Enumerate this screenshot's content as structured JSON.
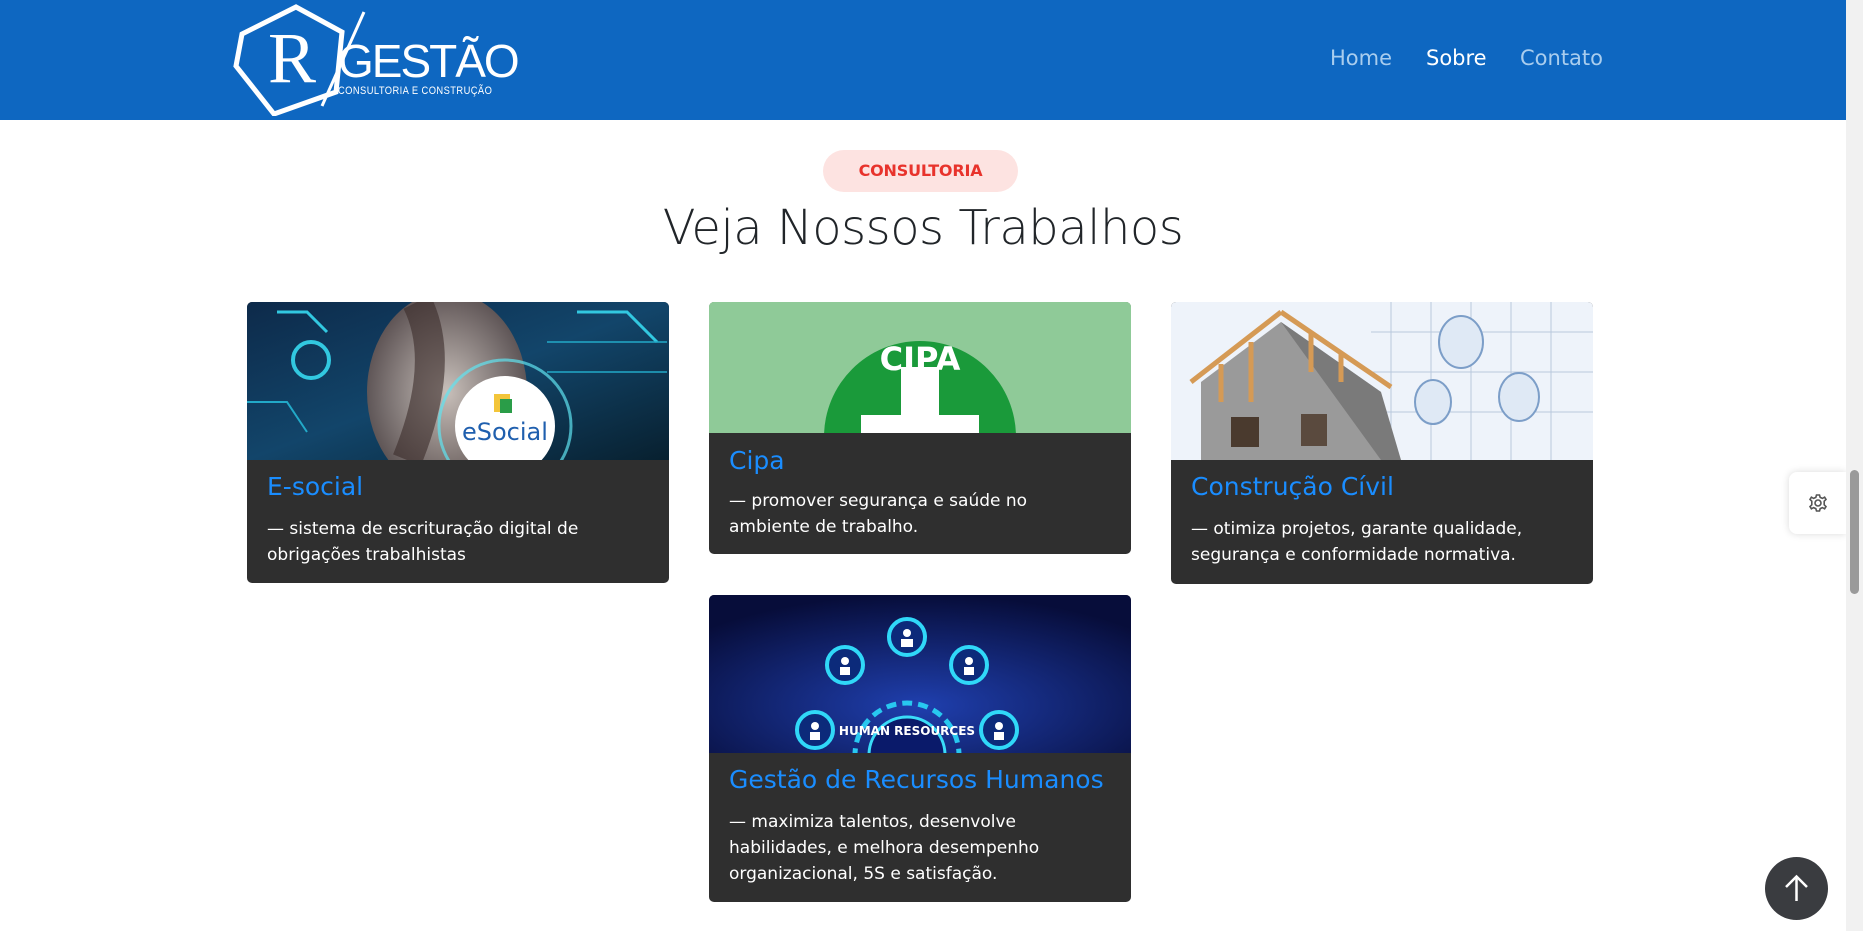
{
  "brand": {
    "logo_letter": "R",
    "name": "GESTÃO",
    "tagline": "CONSULTORIA E CONSTRUÇÃO"
  },
  "nav": {
    "home": "Home",
    "sobre": "Sobre",
    "contato": "Contato",
    "active": "Sobre"
  },
  "section": {
    "badge": "CONSULTORIA",
    "title": "Veja Nossos Trabalhos"
  },
  "cards": [
    {
      "title": "E-social",
      "text": "—  sistema de escrituração digital de obrigações trabalhistas",
      "image_text": "eSocial",
      "image": "esocial-tech-image"
    },
    {
      "title": "Cipa",
      "text": "— promover segurança e saúde no ambiente de trabalho.",
      "image_text": "CIPA",
      "image": "cipa-logo-image"
    },
    {
      "title": "Construção Cívil",
      "text": "— otimiza projetos, garante qualidade, segurança e conformidade normativa.",
      "image": "house-construction-image"
    },
    {
      "title": "Gestão de Recursos Humanos",
      "text": "—  maximiza talentos, desenvolve habilidades, e melhora desempenho organizacional, 5S e satisfação.",
      "image_text": "HUMAN RESOURCES",
      "image": "human-resources-image"
    }
  ],
  "icons": {
    "settings": "gear-icon",
    "back_to_top": "arrow-up-icon"
  },
  "colors": {
    "navbar": "#0e67c1",
    "card_bg": "#2f2f2f",
    "card_title": "#1a8dff",
    "badge_bg": "#fde3e1",
    "badge_text": "#e8332c"
  }
}
